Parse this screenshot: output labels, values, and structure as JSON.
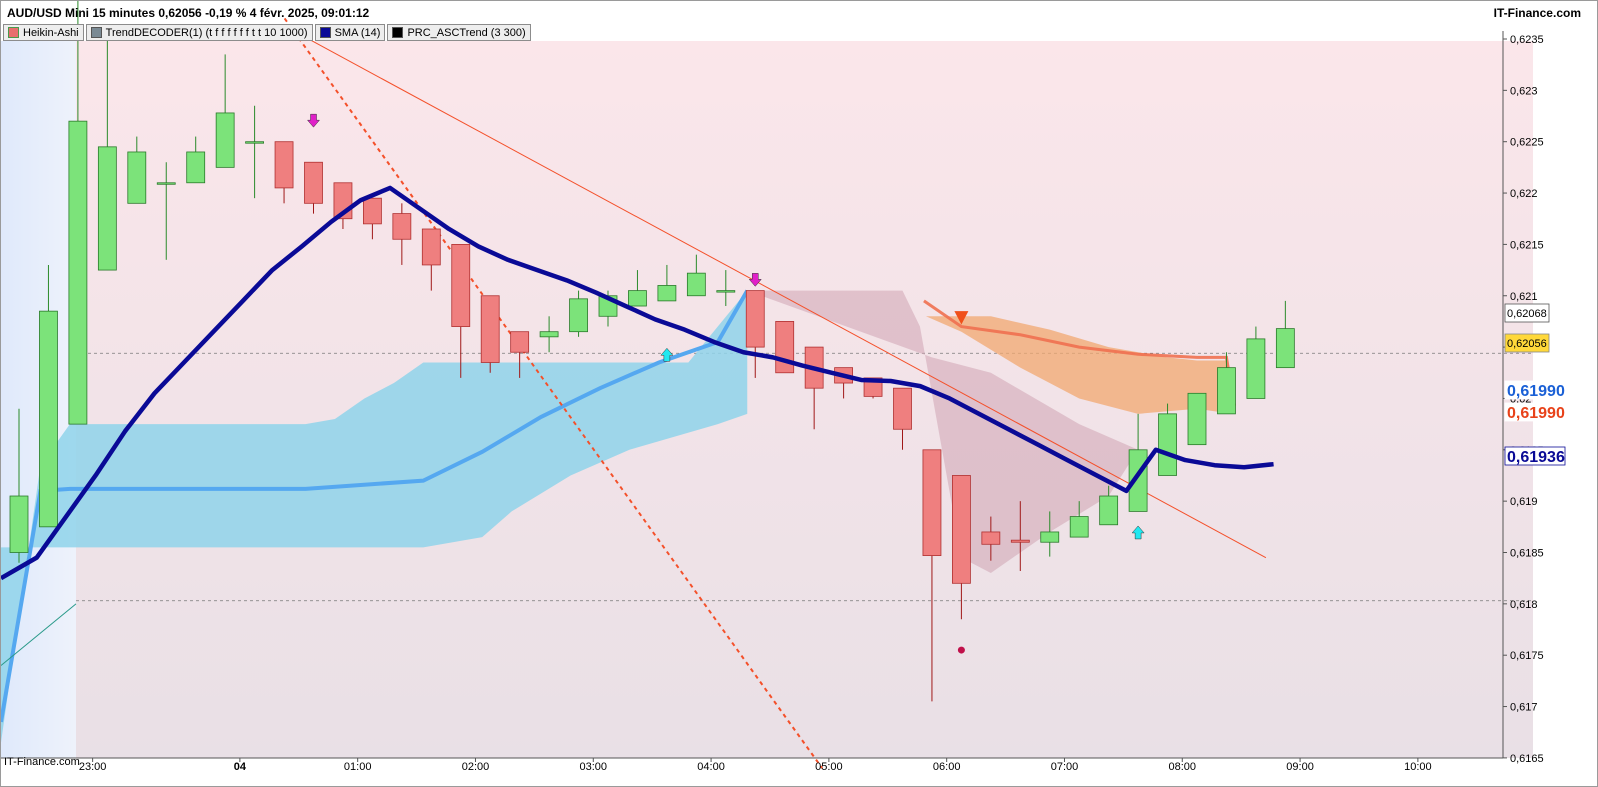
{
  "header": {
    "title": "AUD/USD Mini 15 minutes 0,62056 -0,19 % 4 févr. 2025, 09:01:12",
    "site": "IT-Finance.com"
  },
  "legend": [
    {
      "label": "Heikin-Ashi",
      "color": "#e86e6e"
    },
    {
      "label": "TrendDECODER(1) (t f f f f f f t t 10 1000)",
      "color": "#7a8a94"
    },
    {
      "label": "SMA (14)",
      "color": "#0a0a96"
    },
    {
      "label": "PRC_ASCTrend (3 300)",
      "color": "#000000"
    }
  ],
  "watermark": "IT-Finance.com",
  "colors": {
    "bull_candle": "#7ce37a",
    "bear_candle": "#ef7f7f",
    "sma": "#0a0a96",
    "cloud_blue": "#8fd3ea",
    "cloud_orange": "#f2a870",
    "trendline": "#f4502a",
    "price_tag": "#ffd83a",
    "tag_blue": "#1a60d6",
    "tag_red": "#e8421a"
  },
  "chart_data": {
    "type": "candlestick",
    "title": "AUD/USD Mini 15 minutes",
    "ylim": [
      0.6163,
      0.6238
    ],
    "y_ticks": [
      "0,6235",
      "0,623",
      "0,6225",
      "0,622",
      "0,6215",
      "0,621",
      "0,6205",
      "0,62",
      "0,6195",
      "0,619",
      "0,6185",
      "0,618",
      "0,6175",
      "0,617",
      "0,6165"
    ],
    "x_ticks": [
      {
        "label": "23:00",
        "index": 2.5
      },
      {
        "label": "04",
        "index": 7.5,
        "bold": true
      },
      {
        "label": "01:00",
        "index": 11.5
      },
      {
        "label": "02:00",
        "index": 15.5
      },
      {
        "label": "03:00",
        "index": 19.5
      },
      {
        "label": "04:00",
        "index": 23.5
      },
      {
        "label": "05:00",
        "index": 27.5
      },
      {
        "label": "06:00",
        "index": 31.5
      },
      {
        "label": "07:00",
        "index": 35.5
      },
      {
        "label": "08:00",
        "index": 39.5
      },
      {
        "label": "09:00",
        "index": 43.5
      },
      {
        "label": "10:00",
        "index": 47.5
      }
    ],
    "candles": [
      {
        "o": 0.6185,
        "h": 0.6199,
        "l": 0.6184,
        "c": 0.61905
      },
      {
        "o": 0.61875,
        "h": 0.6213,
        "l": 0.61875,
        "c": 0.62085
      },
      {
        "o": 0.61975,
        "h": 0.624,
        "l": 0.61975,
        "c": 0.6227
      },
      {
        "o": 0.62125,
        "h": 0.6235,
        "l": 0.62125,
        "c": 0.62245
      },
      {
        "o": 0.6219,
        "h": 0.62255,
        "l": 0.6219,
        "c": 0.6224
      },
      {
        "o": 0.6221,
        "h": 0.6223,
        "l": 0.62135,
        "c": 0.6221
      },
      {
        "o": 0.6221,
        "h": 0.62255,
        "l": 0.6221,
        "c": 0.6224
      },
      {
        "o": 0.62225,
        "h": 0.62335,
        "l": 0.62225,
        "c": 0.62278
      },
      {
        "o": 0.6225,
        "h": 0.62285,
        "l": 0.62195,
        "c": 0.6225
      },
      {
        "o": 0.6225,
        "h": 0.6225,
        "l": 0.6219,
        "c": 0.62205
      },
      {
        "o": 0.6223,
        "h": 0.6223,
        "l": 0.6218,
        "c": 0.6219
      },
      {
        "o": 0.6221,
        "h": 0.6221,
        "l": 0.62165,
        "c": 0.62175
      },
      {
        "o": 0.62195,
        "h": 0.62195,
        "l": 0.62155,
        "c": 0.6217
      },
      {
        "o": 0.6218,
        "h": 0.6219,
        "l": 0.6213,
        "c": 0.62155
      },
      {
        "o": 0.62165,
        "h": 0.62165,
        "l": 0.62105,
        "c": 0.6213
      },
      {
        "o": 0.6215,
        "h": 0.6215,
        "l": 0.6202,
        "c": 0.6207
      },
      {
        "o": 0.621,
        "h": 0.621,
        "l": 0.62025,
        "c": 0.62035
      },
      {
        "o": 0.62065,
        "h": 0.62065,
        "l": 0.6202,
        "c": 0.62045
      },
      {
        "o": 0.6206,
        "h": 0.6208,
        "l": 0.62045,
        "c": 0.62065
      },
      {
        "o": 0.62065,
        "h": 0.62105,
        "l": 0.6206,
        "c": 0.62097
      },
      {
        "o": 0.6208,
        "h": 0.62105,
        "l": 0.6207,
        "c": 0.621
      },
      {
        "o": 0.6209,
        "h": 0.62125,
        "l": 0.6209,
        "c": 0.62105
      },
      {
        "o": 0.62095,
        "h": 0.6213,
        "l": 0.62095,
        "c": 0.6211
      },
      {
        "o": 0.621,
        "h": 0.6214,
        "l": 0.621,
        "c": 0.62122
      },
      {
        "o": 0.62105,
        "h": 0.62125,
        "l": 0.6209,
        "c": 0.62105
      },
      {
        "o": 0.62105,
        "h": 0.62105,
        "l": 0.6202,
        "c": 0.6205
      },
      {
        "o": 0.62075,
        "h": 0.62075,
        "l": 0.6203,
        "c": 0.62025
      },
      {
        "o": 0.6205,
        "h": 0.6205,
        "l": 0.6197,
        "c": 0.6201
      },
      {
        "o": 0.6203,
        "h": 0.6203,
        "l": 0.62,
        "c": 0.62015
      },
      {
        "o": 0.6202,
        "h": 0.6202,
        "l": 0.62,
        "c": 0.62002
      },
      {
        "o": 0.6201,
        "h": 0.6201,
        "l": 0.6195,
        "c": 0.6197
      },
      {
        "o": 0.6195,
        "h": 0.6195,
        "l": 0.61705,
        "c": 0.61847
      },
      {
        "o": 0.61925,
        "h": 0.61925,
        "l": 0.61785,
        "c": 0.6182
      },
      {
        "o": 0.6187,
        "h": 0.61885,
        "l": 0.61842,
        "c": 0.61858
      },
      {
        "o": 0.61862,
        "h": 0.619,
        "l": 0.61832,
        "c": 0.6186
      },
      {
        "o": 0.6186,
        "h": 0.6189,
        "l": 0.61846,
        "c": 0.6187
      },
      {
        "o": 0.61865,
        "h": 0.619,
        "l": 0.61865,
        "c": 0.61885
      },
      {
        "o": 0.61877,
        "h": 0.61915,
        "l": 0.61877,
        "c": 0.61905
      },
      {
        "o": 0.6189,
        "h": 0.61985,
        "l": 0.6189,
        "c": 0.6195
      },
      {
        "o": 0.61925,
        "h": 0.61995,
        "l": 0.61925,
        "c": 0.61985
      },
      {
        "o": 0.61955,
        "h": 0.62005,
        "l": 0.61955,
        "c": 0.62005
      },
      {
        "o": 0.61985,
        "h": 0.62045,
        "l": 0.61985,
        "c": 0.6203
      },
      {
        "o": 0.62,
        "h": 0.6207,
        "l": 0.62,
        "c": 0.62058
      },
      {
        "o": 0.6203,
        "h": 0.62095,
        "l": 0.6203,
        "c": 0.62068
      }
    ],
    "sma_values": [
      0.61825,
      0.61845,
      0.61885,
      0.61925,
      0.61968,
      0.62005,
      0.62035,
      0.62065,
      0.62095,
      0.62125,
      0.62148,
      0.62172,
      0.62193,
      0.62205,
      0.62185,
      0.62165,
      0.62148,
      0.62135,
      0.62125,
      0.62115,
      0.62103,
      0.6209,
      0.62077,
      0.62067,
      0.62055,
      0.62045,
      0.6204,
      0.62032,
      0.62025,
      0.62018,
      0.62017,
      0.62012,
      0.62,
      0.61985,
      0.6197,
      0.61955,
      0.6194,
      0.61925,
      0.6191,
      0.6195,
      0.6194,
      0.61935,
      0.61933,
      0.61936
    ],
    "price_labels": {
      "close_above": "0,62068",
      "current": "0,62056",
      "level_blue": "0,61990",
      "level_red": "0,61990",
      "sma": "0,61936"
    }
  }
}
